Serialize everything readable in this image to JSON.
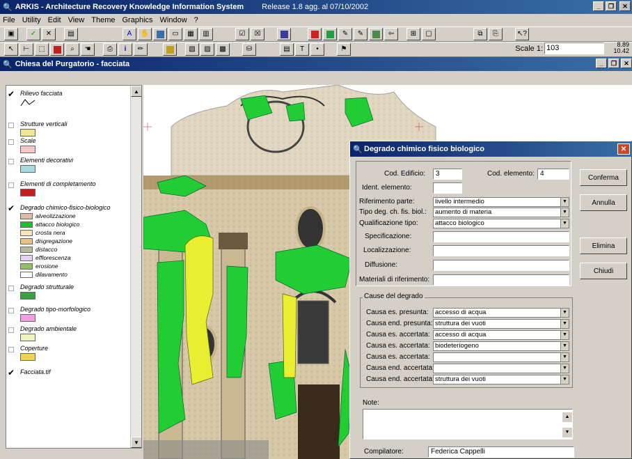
{
  "app": {
    "title": "ARKIS - Architecture Recovery Knowledge Information System",
    "release": "Release 1.8  agg. al 07/10/2002"
  },
  "menu": [
    "File",
    "Utility",
    "Edit",
    "View",
    "Theme",
    "Graphics",
    "Window",
    "?"
  ],
  "toolbar": {
    "scale_label": "Scale 1:",
    "scale_value": "103",
    "coord_x": "8.89",
    "coord_y": "10.42"
  },
  "child_window": {
    "title": "Chiesa del Purgatorio - facciata"
  },
  "layers": [
    {
      "label": "Rilievo facciata",
      "checked": true
    },
    {
      "label": "Strutture verticali",
      "checked": false
    },
    {
      "label": "Scale",
      "checked": false
    },
    {
      "label": "Elementi decorativi",
      "checked": false
    },
    {
      "label": "Elementi di completamento",
      "checked": false
    },
    {
      "label": "Degrado chimico-fisico-biologico",
      "checked": true
    },
    {
      "label": "Degrado strutturale",
      "checked": false
    },
    {
      "label": "Degrado tipo-morfologico",
      "checked": false
    },
    {
      "label": "Degrado ambientale",
      "checked": false
    },
    {
      "label": "Coperture",
      "checked": false
    },
    {
      "label": "Facciata.tif",
      "checked": true
    }
  ],
  "degrado_items": [
    {
      "label": "alveolizzazione",
      "color": "#e0b8a8"
    },
    {
      "label": "attacco biologico",
      "color": "#22bb33"
    },
    {
      "label": "crosta nera",
      "color": "#f4e6b8"
    },
    {
      "label": "disgregazione",
      "color": "#e8c080"
    },
    {
      "label": "distacco",
      "color": "#b8b8a0"
    },
    {
      "label": "efflorescenza",
      "color": "#e8d0f0"
    },
    {
      "label": "erosione",
      "color": "#90c060"
    },
    {
      "label": "dilavamento",
      "color": "#ffffff"
    }
  ],
  "checkmark": "✔",
  "dialog": {
    "title": "Degrado chimico fisico biologico",
    "cod_edificio_label": "Cod. Edificio:",
    "cod_edificio": "3",
    "cod_elemento_label": "Cod. elemento:",
    "cod_elemento": "4",
    "ident_label": "Ident. elemento:",
    "ident_value": "",
    "rif_label": "Riferimento parte:",
    "rif_value": "livello intermedio",
    "tipo_label": "Tipo deg. ch. fis. biol.:",
    "tipo_value": "aumento di materia",
    "qual_label": "Qualificazione tipo:",
    "qual_value": "attacco biologico",
    "spec_label": "Specificazione:",
    "loc_label": "Localizzazione:",
    "diff_label": "Diffusione:",
    "mat_label": "Materiali di riferimento:",
    "cause_label": "Cause del degrado",
    "cause": [
      {
        "label": "Causa es. presunta:",
        "value": "accesso di acqua"
      },
      {
        "label": "Causa end. presunta:",
        "value": "struttura dei vuoti"
      },
      {
        "label": "Causa es. accertata:",
        "value": "accesso di acqua"
      },
      {
        "label": "Causa es. accertata:",
        "value": "biodeteriogeno"
      },
      {
        "label": "Causa es. accertata:",
        "value": ""
      },
      {
        "label": "Causa end. accertata:",
        "value": ""
      },
      {
        "label": "Causa end. accertata:",
        "value": "struttura dei vuoti"
      }
    ],
    "note_label": "Note:",
    "compilatore_label": "Compilatore:",
    "compilatore": "Federica Cappelli",
    "btn_conferma": "Conferma",
    "btn_annulla": "Annulla",
    "btn_elimina": "Elimina",
    "btn_chiudi": "Chiudi"
  }
}
